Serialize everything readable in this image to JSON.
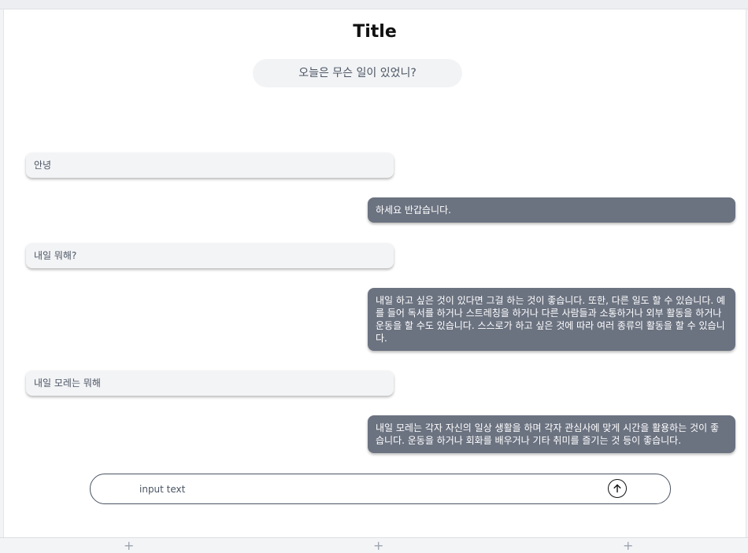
{
  "header": {
    "title": "Title",
    "prompt": "오늘은 무슨 일이 있었니?"
  },
  "messages": [
    {
      "role": "user",
      "text": "안녕"
    },
    {
      "role": "bot",
      "text": "하세요 반갑습니다."
    },
    {
      "role": "user",
      "text": "내일 뭐해?"
    },
    {
      "role": "bot",
      "text": "내일 하고 싶은 것이 있다면 그걸 하는 것이 좋습니다. 또한, 다른 일도 할 수 있습니다. 예를 들어 독서를 하거나 스트레칭을 하거나 다른 사람들과 소통하거나 외부 활동을 하거나 운동을 할 수도 있습니다. 스스로가 하고 싶은 것에 따라 여러 종류의 활동을 할 수 있습니다."
    },
    {
      "role": "user",
      "text": "내일 모레는 뭐해"
    },
    {
      "role": "bot",
      "text": "내일 모레는 각자 자신의 일상 생활을 하며 각자 관심사에 맞게 시간을 활용하는 것이 좋습니다. 운동을 하거나 회화를 배우거나 기타 취미를 즐기는 것 등이 좋습니다."
    }
  ],
  "input": {
    "placeholder": "input text",
    "value": ""
  },
  "send_button": {
    "icon": "arrow-up-icon"
  },
  "footer": {
    "plus_icons": [
      "+",
      "+",
      "+"
    ]
  },
  "colors": {
    "bot_bubble": "#6b7280",
    "user_bubble": "#f3f4f6",
    "prompt_pill": "#f2f3f5"
  }
}
